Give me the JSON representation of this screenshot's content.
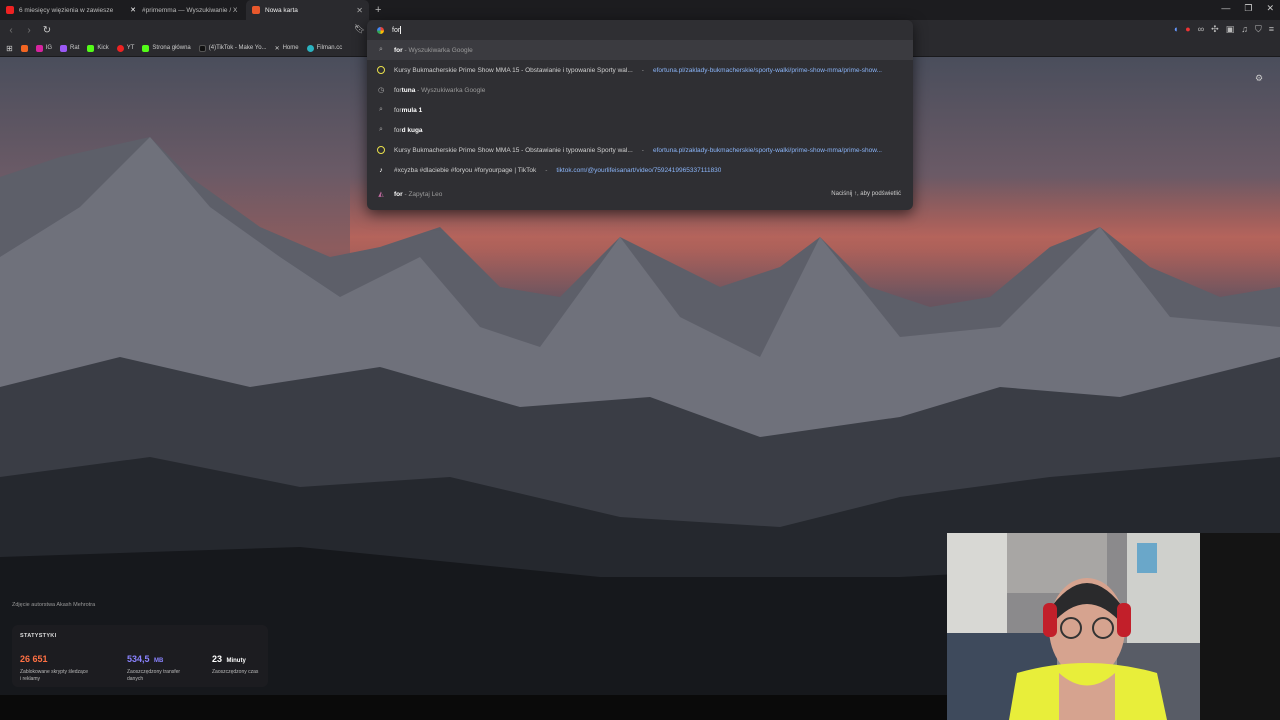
{
  "tabs": [
    {
      "title": "6 miesięcy więzienia w zawiesze",
      "favicon": "youtube-favicon",
      "active": false
    },
    {
      "title": "#primemma — Wyszukiwanie / X",
      "favicon": "x-favicon",
      "active": false
    },
    {
      "title": "Nowa karta",
      "favicon": "brave-favicon",
      "active": true
    }
  ],
  "toolbar": {
    "address_value": "for"
  },
  "bookmarks": [
    {
      "label": "",
      "icon": "grid-icon"
    },
    {
      "label": "",
      "icon": "rss-icon"
    },
    {
      "label": "IG"
    },
    {
      "label": "Rat"
    },
    {
      "label": "Kick"
    },
    {
      "label": "YT"
    },
    {
      "label": "Strona główna"
    },
    {
      "label": "(4)TikTok - Make Yo..."
    },
    {
      "label": "Home"
    },
    {
      "label": "Filman.cc"
    }
  ],
  "suggestions": [
    {
      "type": "search",
      "bold": "for",
      "rest": "",
      "suffix": " - Wyszukiwarka Google",
      "url": ""
    },
    {
      "type": "fortuna",
      "bold": "",
      "rest": "Kursy Bukmacherskie Prime Show MMA 15 - Obstawianie i typowanie Sporty wal...",
      "suffix": " - ",
      "url": "efortuna.pl/zaklady-bukmacherskie/sporty-walki/prime-show-mma/prime-show..."
    },
    {
      "type": "history",
      "bold": "for",
      "rest": "tuna",
      "suffix": " - Wyszukiwarka Google",
      "url": ""
    },
    {
      "type": "search",
      "bold": "for",
      "rest": "mula 1",
      "suffix": "",
      "url": ""
    },
    {
      "type": "search",
      "bold": "for",
      "rest": "d kuga",
      "suffix": "",
      "url": ""
    },
    {
      "type": "fortuna",
      "bold": "",
      "rest": "Kursy Bukmacherskie Prime Show MMA 15 - Obstawianie i typowanie Sporty wal...",
      "suffix": " - ",
      "url": "efortuna.pl/zaklady-bukmacherskie/sporty-walki/prime-show-mma/prime-show..."
    },
    {
      "type": "tiktok",
      "bold": "",
      "rest": "#xcyzba #dlaciebie #foryou #foryourpage | TikTok",
      "suffix": " - ",
      "url": "tiktok.com/@yourlifeisanart/video/7592419965337111830"
    }
  ],
  "leo": {
    "query": "for",
    "label": " - Zapytaj Leo",
    "hint": "Naciśnij ↑, aby podświetlić"
  },
  "credit": "Zdjęcie autorstwa Akash Mehrotra",
  "stats": {
    "title": "STATYSTYKI",
    "items": [
      {
        "value": "26 651",
        "unit": "",
        "label": "Zablokowane skrypty śledzące i reklamy",
        "color": "#ff7043"
      },
      {
        "value": "534,5",
        "unit": "MB",
        "label": "Zaoszczędzony transfer danych",
        "color": "#8a83ff"
      },
      {
        "value": "23",
        "unit": "Minuty",
        "label": "Zaoszczędzony czas",
        "color": "#ffffff"
      }
    ]
  }
}
